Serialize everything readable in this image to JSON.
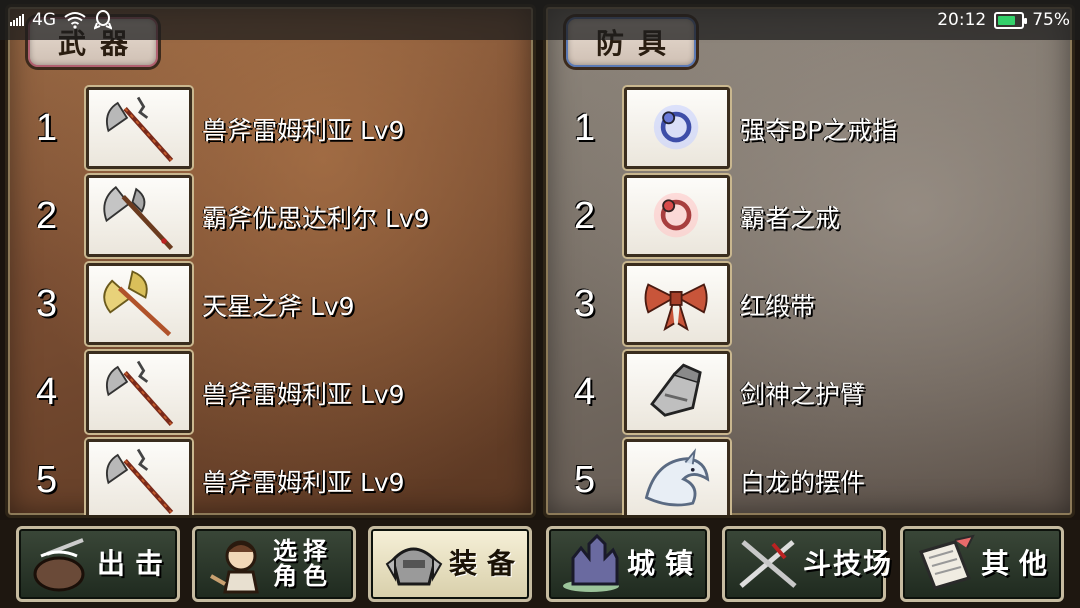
{
  "status_bar": {
    "network": "4G",
    "time": "20:12",
    "battery": "75%",
    "battery_level": 0.75
  },
  "weapon_panel": {
    "title": "武器",
    "items": [
      {
        "number": "1",
        "name": "兽斧雷姆利亚 Lv9",
        "icon": "axe-icon"
      },
      {
        "number": "2",
        "name": "霸斧优思达利尔 Lv9",
        "icon": "axe-icon"
      },
      {
        "number": "3",
        "name": "天星之斧 Lv9",
        "icon": "golden-axe-icon"
      },
      {
        "number": "4",
        "name": "兽斧雷姆利亚 Lv9",
        "icon": "axe-icon"
      },
      {
        "number": "5",
        "name": "兽斧雷姆利亚 Lv9",
        "icon": "axe-icon"
      }
    ]
  },
  "armor_panel": {
    "title": "防具",
    "items": [
      {
        "number": "1",
        "name": "强夺BP之戒指",
        "icon": "blue-ring-icon"
      },
      {
        "number": "2",
        "name": "霸者之戒",
        "icon": "red-ring-icon"
      },
      {
        "number": "3",
        "name": "红缎带",
        "icon": "red-ribbon-icon"
      },
      {
        "number": "4",
        "name": "剑神之护臂",
        "icon": "gauntlet-icon"
      },
      {
        "number": "5",
        "name": "白龙的摆件",
        "icon": "white-dragon-icon"
      }
    ]
  },
  "nav": {
    "sortie": "出击",
    "select_character": "选择角色",
    "select_line1": "选择",
    "select_line2": "角色",
    "equipment": "装备",
    "town": "城镇",
    "arena": "斗技场",
    "other": "其他"
  }
}
